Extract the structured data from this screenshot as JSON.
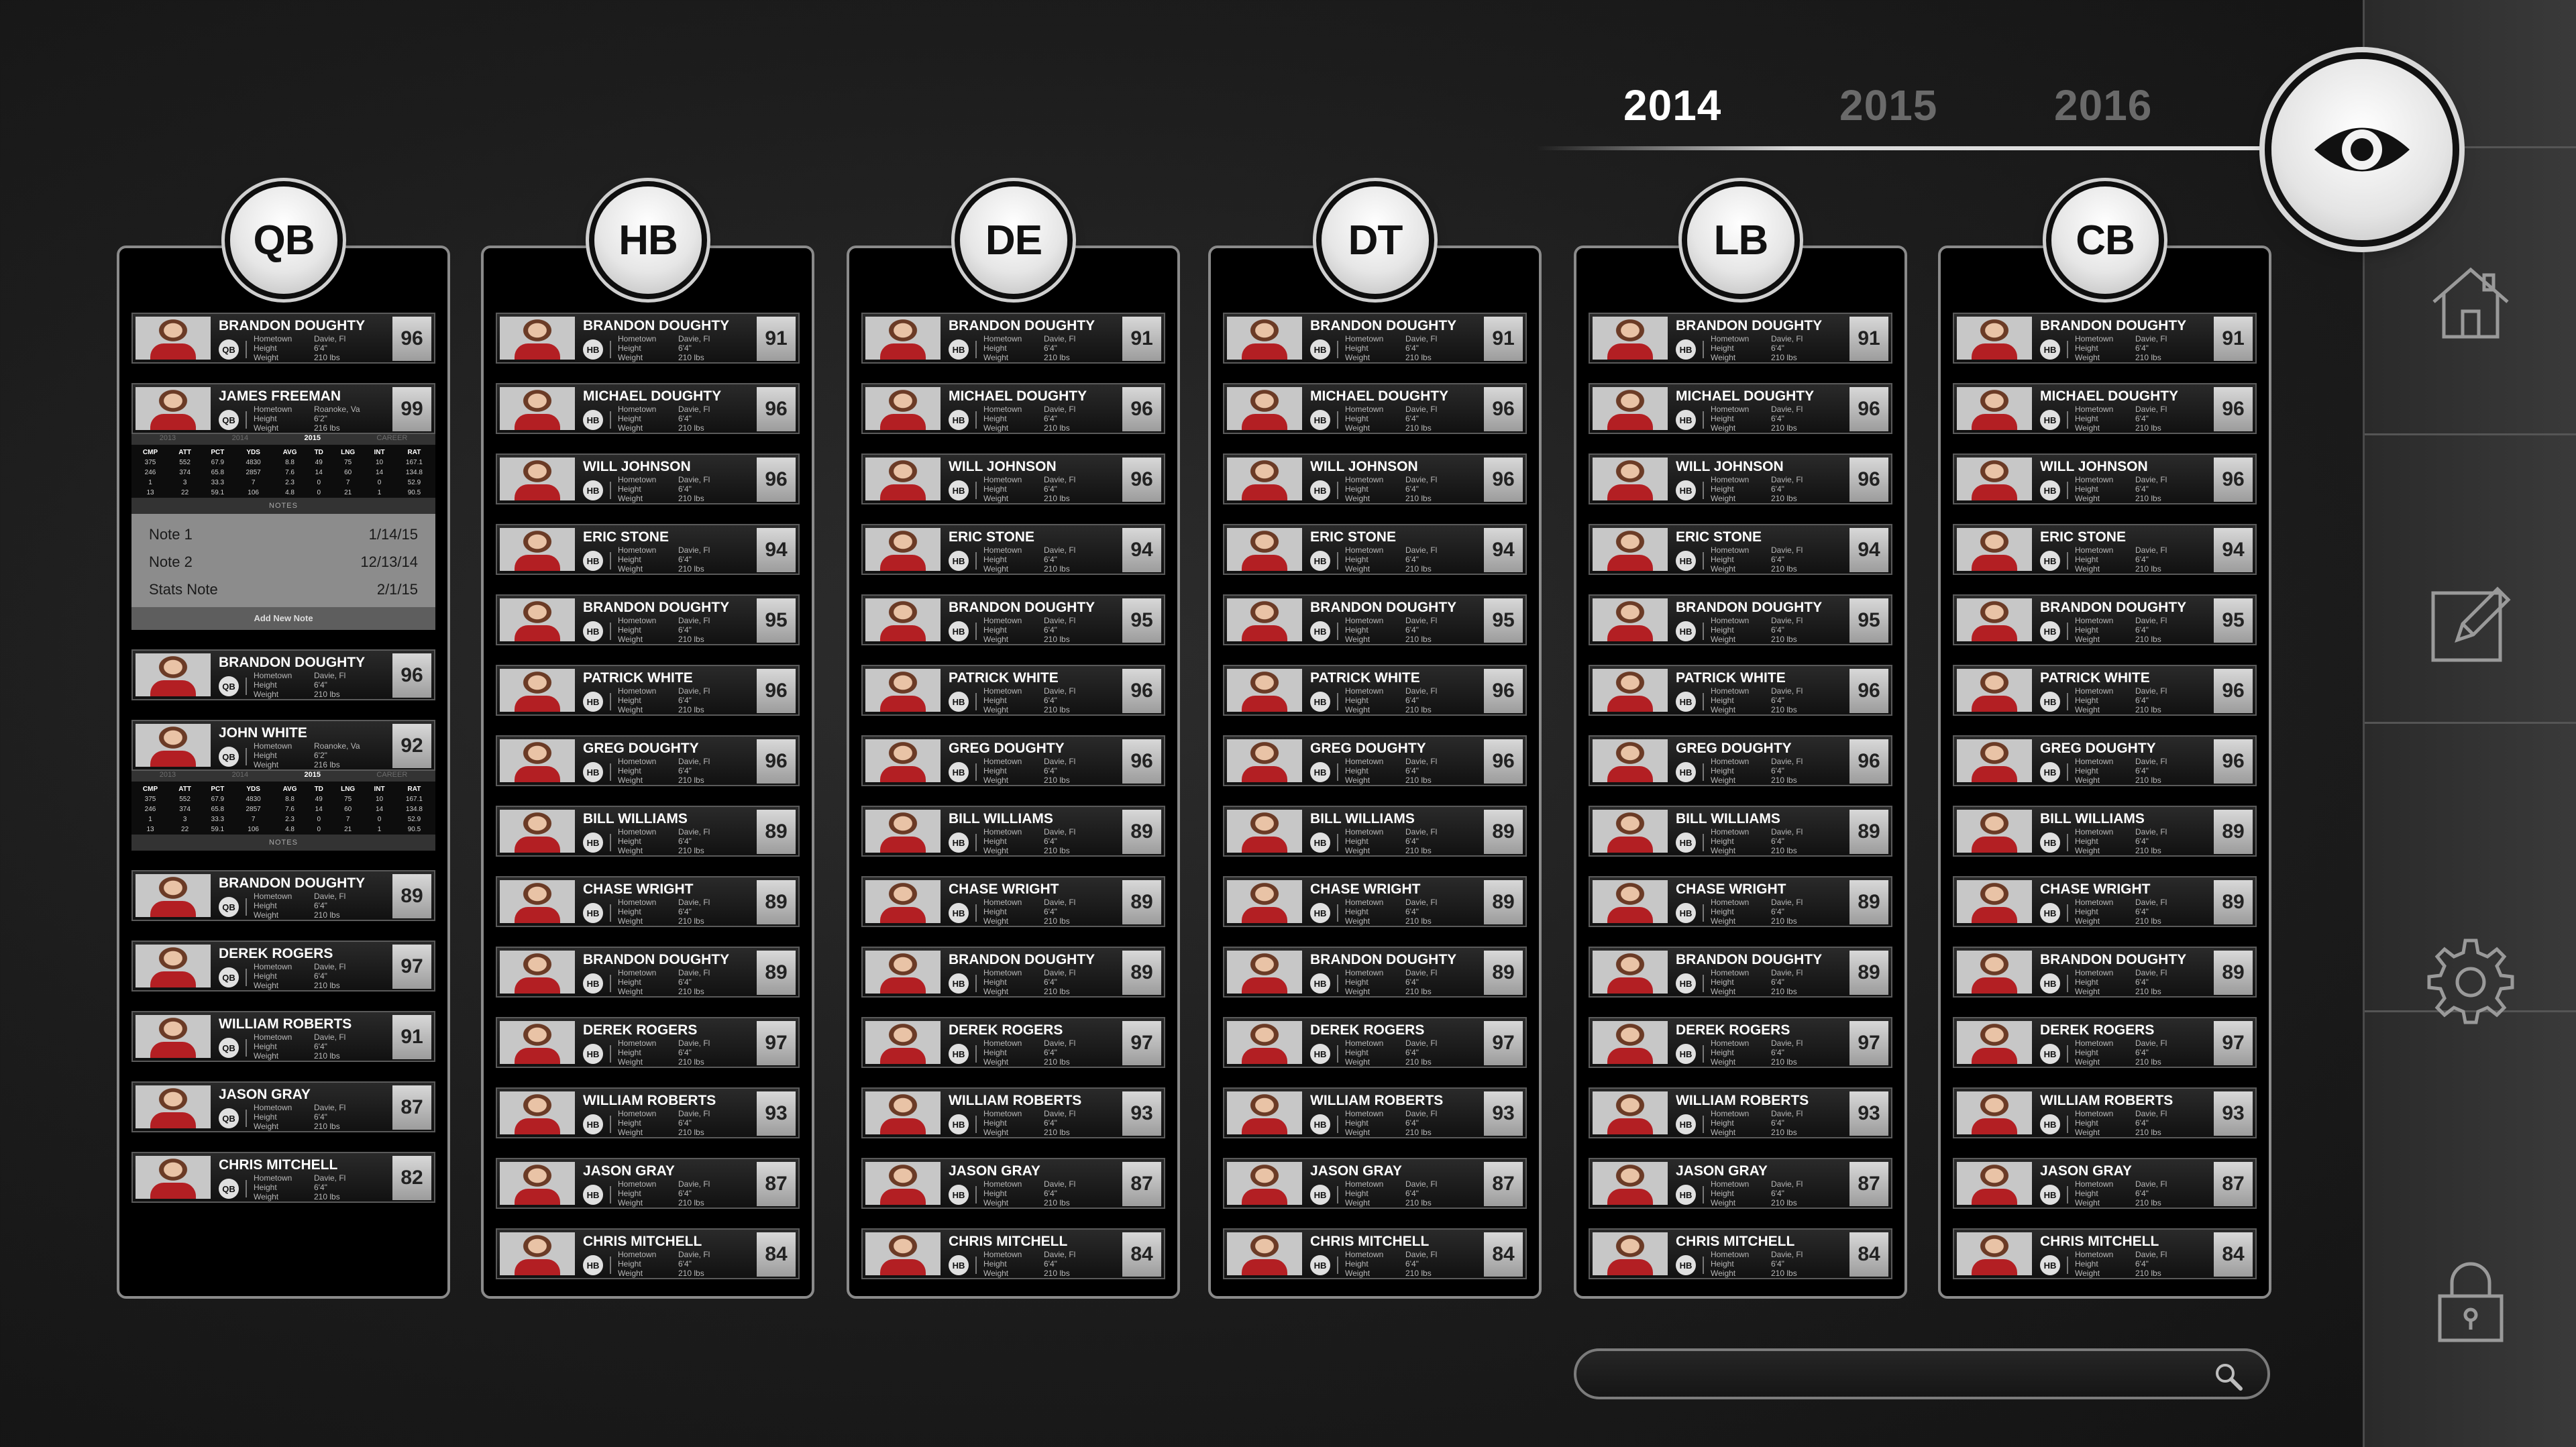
{
  "years": {
    "items": [
      {
        "label": "2014",
        "active": true
      },
      {
        "label": "2015",
        "active": false
      },
      {
        "label": "2016",
        "active": false
      }
    ]
  },
  "icons": {
    "eye": "eye-icon",
    "home": "home-icon",
    "edit": "edit-icon",
    "settings": "gear-icon",
    "lock": "lock-icon",
    "search": "search-icon"
  },
  "colors": {
    "accent": "#ffffff",
    "inactive": "#6a6a6a",
    "jersey": "#b31f23"
  },
  "info_labels": {
    "hometown": "Hometown",
    "height": "Height",
    "weight": "Weight"
  },
  "columns": [
    {
      "position": "QB",
      "players": [
        {
          "name": "BRANDON DOUGHTY",
          "chip": "QB",
          "hometown": "Davie, Fl",
          "height": "6'4\"",
          "weight": "210 lbs",
          "rating": "96"
        },
        {
          "name": "JAMES FREEMAN",
          "chip": "QB",
          "hometown": "Roanoke, Va",
          "height": "6'2\"",
          "weight": "216 lbs",
          "rating": "99",
          "expanded": {
            "years": [
              "2013",
              "2014",
              "2015",
              "CAREER"
            ],
            "active_year": "2015",
            "headers": [
              "CMP",
              "ATT",
              "PCT",
              "YDS",
              "AVG",
              "TD",
              "LNG",
              "INT",
              "RAT"
            ],
            "rows": [
              [
                "375",
                "552",
                "67.9",
                "4830",
                "8.8",
                "49",
                "75",
                "10",
                "167.1"
              ],
              [
                "246",
                "374",
                "65.8",
                "2857",
                "7.6",
                "14",
                "60",
                "14",
                "134.8"
              ],
              [
                "1",
                "3",
                "33.3",
                "7",
                "2.3",
                "0",
                "7",
                "0",
                "52.9"
              ],
              [
                "13",
                "22",
                "59.1",
                "106",
                "4.8",
                "0",
                "21",
                "1",
                "90.5"
              ]
            ],
            "notes_label": "NOTES",
            "notes": [
              {
                "title": "Note 1",
                "date": "1/14/15"
              },
              {
                "title": "Note 2",
                "date": "12/13/14"
              },
              {
                "title": "Stats Note",
                "date": "2/1/15"
              }
            ],
            "add_note": "Add New Note"
          }
        },
        {
          "name": "BRANDON DOUGHTY",
          "chip": "QB",
          "hometown": "Davie, Fl",
          "height": "6'4\"",
          "weight": "210 lbs",
          "rating": "96"
        },
        {
          "name": "JOHN WHITE",
          "chip": "QB",
          "hometown": "Roanoke, Va",
          "height": "6'2\"",
          "weight": "216 lbs",
          "rating": "92",
          "expanded": {
            "years": [
              "2013",
              "2014",
              "2015",
              "CAREER"
            ],
            "active_year": "2015",
            "headers": [
              "CMP",
              "ATT",
              "PCT",
              "YDS",
              "AVG",
              "TD",
              "LNG",
              "INT",
              "RAT"
            ],
            "rows": [
              [
                "375",
                "552",
                "67.9",
                "4830",
                "8.8",
                "49",
                "75",
                "10",
                "167.1"
              ],
              [
                "246",
                "374",
                "65.8",
                "2857",
                "7.6",
                "14",
                "60",
                "14",
                "134.8"
              ],
              [
                "1",
                "3",
                "33.3",
                "7",
                "2.3",
                "0",
                "7",
                "0",
                "52.9"
              ],
              [
                "13",
                "22",
                "59.1",
                "106",
                "4.8",
                "0",
                "21",
                "1",
                "90.5"
              ]
            ],
            "notes_label": "NOTES"
          }
        },
        {
          "name": "BRANDON DOUGHTY",
          "chip": "QB",
          "hometown": "Davie, Fl",
          "height": "6'4\"",
          "weight": "210 lbs",
          "rating": "89"
        },
        {
          "name": "DEREK ROGERS",
          "chip": "QB",
          "hometown": "Davie, Fl",
          "height": "6'4\"",
          "weight": "210 lbs",
          "rating": "97"
        },
        {
          "name": "WILLIAM ROBERTS",
          "chip": "QB",
          "hometown": "Davie, Fl",
          "height": "6'4\"",
          "weight": "210 lbs",
          "rating": "91"
        },
        {
          "name": "JASON GRAY",
          "chip": "QB",
          "hometown": "Davie, Fl",
          "height": "6'4\"",
          "weight": "210 lbs",
          "rating": "87"
        },
        {
          "name": "CHRIS MITCHELL",
          "chip": "QB",
          "hometown": "Davie, Fl",
          "height": "6'4\"",
          "weight": "210 lbs",
          "rating": "82"
        }
      ]
    },
    {
      "position": "HB",
      "roster": "std"
    },
    {
      "position": "DE",
      "roster": "std"
    },
    {
      "position": "DT",
      "roster": "std"
    },
    {
      "position": "LB",
      "roster": "std"
    },
    {
      "position": "CB",
      "roster": "std"
    }
  ],
  "std_roster": [
    {
      "name": "BRANDON DOUGHTY",
      "chip": "HB",
      "hometown": "Davie, Fl",
      "height": "6'4\"",
      "weight": "210 lbs",
      "rating": "91"
    },
    {
      "name": "MICHAEL DOUGHTY",
      "chip": "HB",
      "hometown": "Davie, Fl",
      "height": "6'4\"",
      "weight": "210 lbs",
      "rating": "96"
    },
    {
      "name": "WILL JOHNSON",
      "chip": "HB",
      "hometown": "Davie, Fl",
      "height": "6'4\"",
      "weight": "210 lbs",
      "rating": "96"
    },
    {
      "name": "ERIC STONE",
      "chip": "HB",
      "hometown": "Davie, Fl",
      "height": "6'4\"",
      "weight": "210 lbs",
      "rating": "94"
    },
    {
      "name": "BRANDON DOUGHTY",
      "chip": "HB",
      "hometown": "Davie, Fl",
      "height": "6'4\"",
      "weight": "210 lbs",
      "rating": "95"
    },
    {
      "name": "PATRICK WHITE",
      "chip": "HB",
      "hometown": "Davie, Fl",
      "height": "6'4\"",
      "weight": "210 lbs",
      "rating": "96"
    },
    {
      "name": "GREG DOUGHTY",
      "chip": "HB",
      "hometown": "Davie, Fl",
      "height": "6'4\"",
      "weight": "210 lbs",
      "rating": "96"
    },
    {
      "name": "BILL WILLIAMS",
      "chip": "HB",
      "hometown": "Davie, Fl",
      "height": "6'4\"",
      "weight": "210 lbs",
      "rating": "89"
    },
    {
      "name": "CHASE WRIGHT",
      "chip": "HB",
      "hometown": "Davie, Fl",
      "height": "6'4\"",
      "weight": "210 lbs",
      "rating": "89"
    },
    {
      "name": "BRANDON DOUGHTY",
      "chip": "HB",
      "hometown": "Davie, Fl",
      "height": "6'4\"",
      "weight": "210 lbs",
      "rating": "89"
    },
    {
      "name": "DEREK ROGERS",
      "chip": "HB",
      "hometown": "Davie, Fl",
      "height": "6'4\"",
      "weight": "210 lbs",
      "rating": "97"
    },
    {
      "name": "WILLIAM ROBERTS",
      "chip": "HB",
      "hometown": "Davie, Fl",
      "height": "6'4\"",
      "weight": "210 lbs",
      "rating": "93"
    },
    {
      "name": "JASON GRAY",
      "chip": "HB",
      "hometown": "Davie, Fl",
      "height": "6'4\"",
      "weight": "210 lbs",
      "rating": "87"
    },
    {
      "name": "CHRIS MITCHELL",
      "chip": "HB",
      "hometown": "Davie, Fl",
      "height": "6'4\"",
      "weight": "210 lbs",
      "rating": "84"
    }
  ],
  "search": {
    "placeholder": "",
    "value": ""
  }
}
